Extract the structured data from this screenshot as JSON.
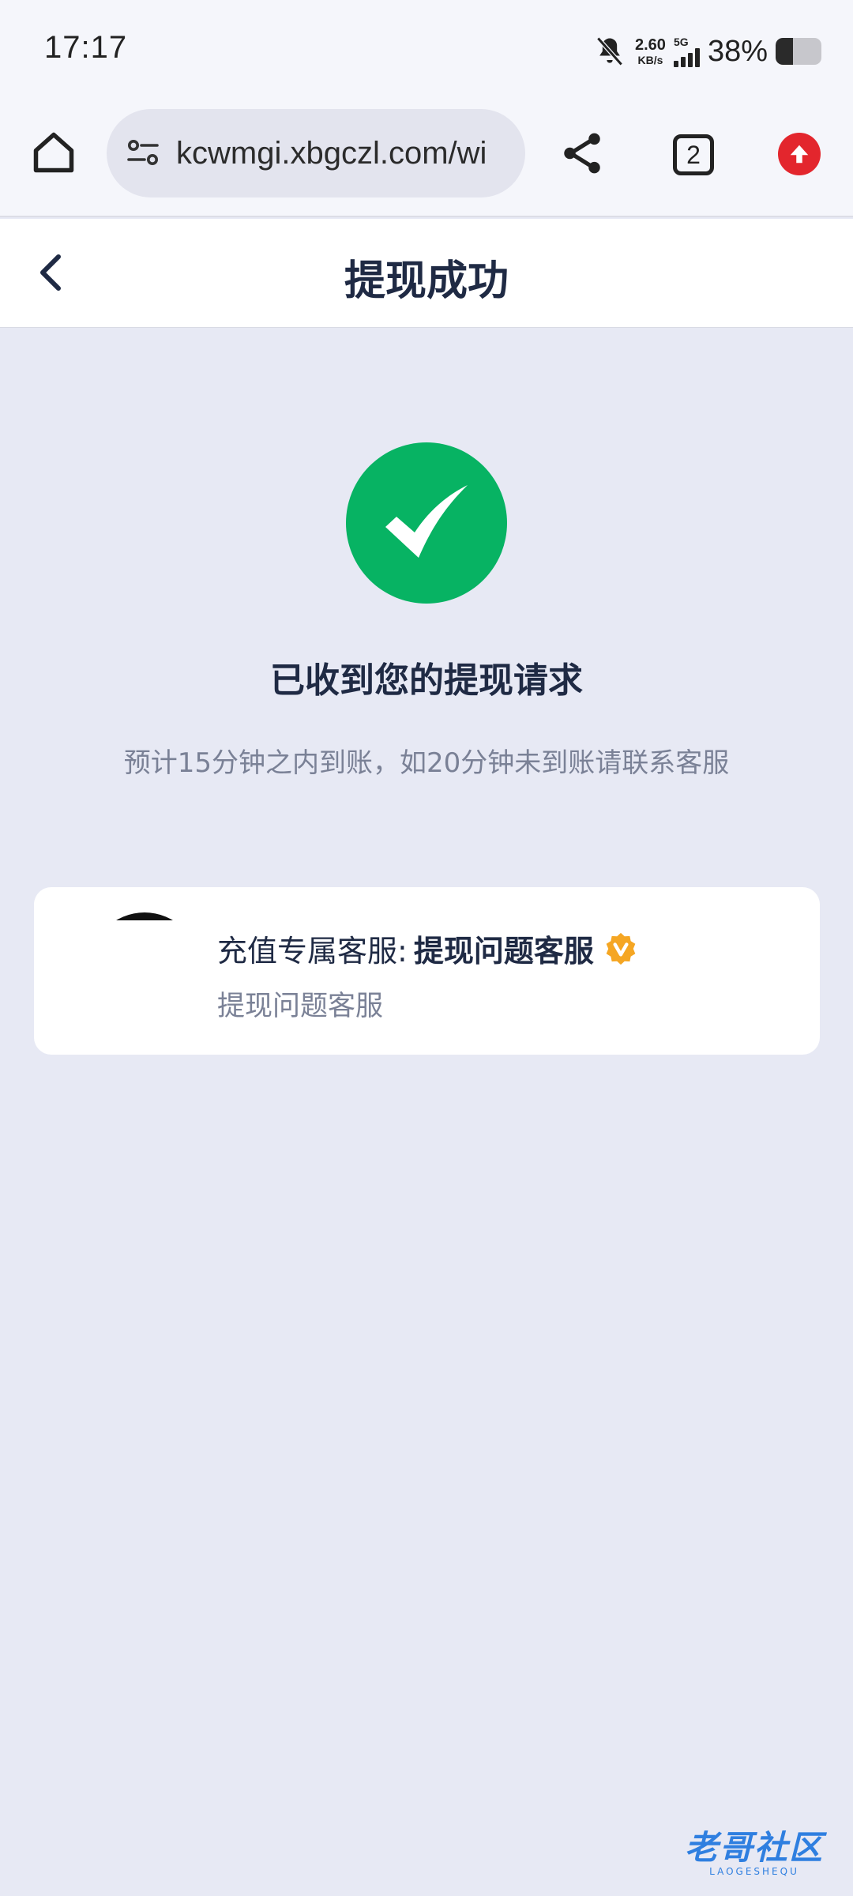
{
  "status_bar": {
    "time": "17:17",
    "net_speed_value": "2.60",
    "net_speed_unit": "KB/s",
    "network_type": "5G",
    "battery_percent": "38%",
    "battery_level": 0.38,
    "icons": [
      "bell-off-icon",
      "signal-icon",
      "battery-icon"
    ]
  },
  "browser": {
    "url": "kcwmgi.xbgczl.com/wi",
    "tab_count": "2",
    "icons": [
      "home-icon",
      "site-settings-icon",
      "share-icon",
      "tabs-icon",
      "upgrade-icon"
    ],
    "upgrade_color": "#e3262d"
  },
  "header": {
    "title": "提现成功",
    "back_icon": "chevron-left-icon"
  },
  "success": {
    "icon": "check-circle-icon",
    "icon_color": "#07b363",
    "title": "已收到您的提现请求",
    "description": "预计15分钟之内到账，如20分钟未到账请联系客服"
  },
  "service_card": {
    "name_label": "充值专属客服:",
    "name_value": "提现问题客服",
    "subtitle": "提现问题客服",
    "verified_icon": "verified-badge-icon",
    "verified_color": "#f5a623"
  },
  "watermark": {
    "text": "老哥社区",
    "sub": "LAOGESHEQU"
  }
}
